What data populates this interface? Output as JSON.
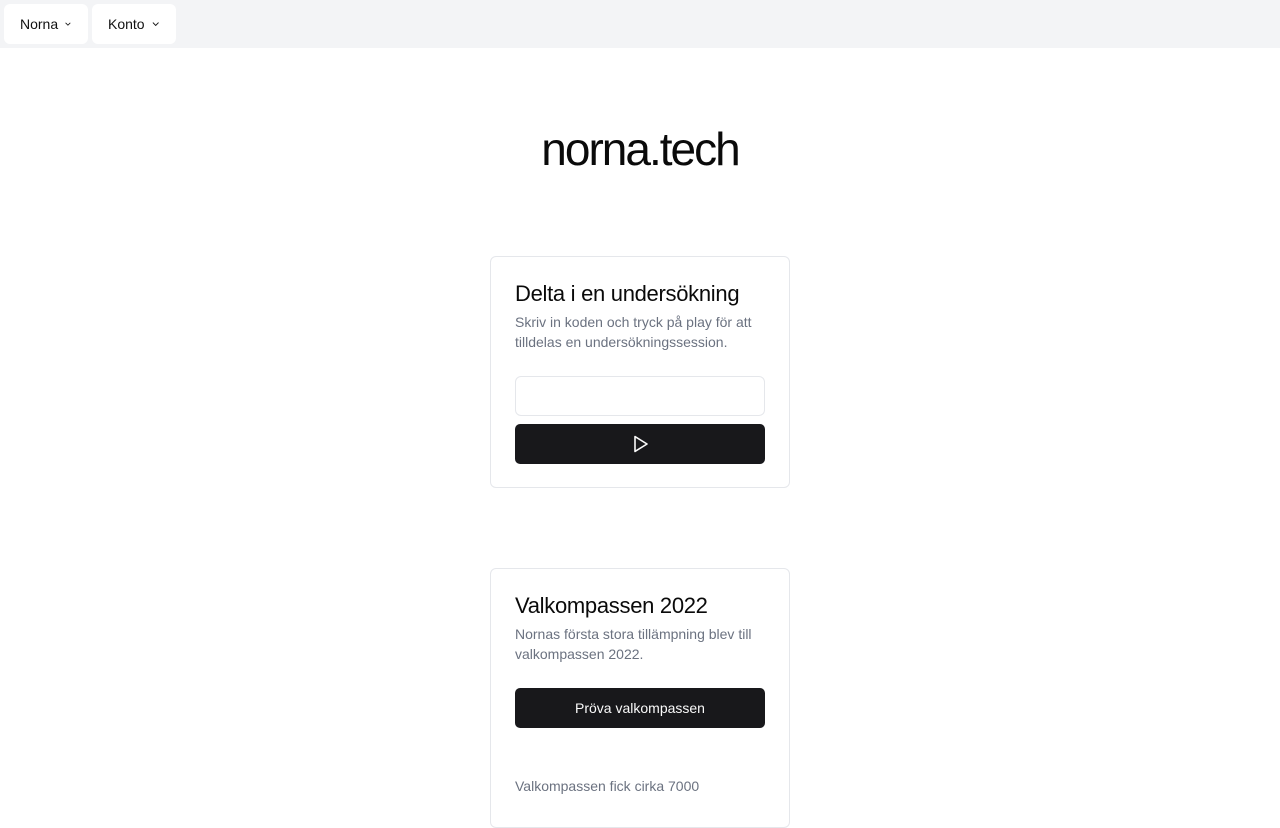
{
  "nav": {
    "items": [
      {
        "label": "Norna",
        "icon": "chevron-down-icon"
      },
      {
        "label": "Konto",
        "icon": "chevron-down-icon"
      }
    ]
  },
  "brand": {
    "title": "norna.tech"
  },
  "join_card": {
    "title": "Delta i en undersökning",
    "description": "Skriv in koden och tryck på play för att tilldelas en undersökningssession.",
    "code_input": {
      "value": "",
      "placeholder": ""
    },
    "play_button_icon": "play-icon"
  },
  "valkompass_card": {
    "title": "Valkompassen 2022",
    "description": "Nornas första stora tillämpning blev till valkompassen 2022.",
    "button_label": "Pröva valkompassen",
    "footer_text": "Valkompassen fick cirka 7000"
  },
  "colors": {
    "topbar_bg": "#f3f4f6",
    "dark_button": "#18181b",
    "muted_text": "#6b7280",
    "border": "#e5e7eb"
  }
}
